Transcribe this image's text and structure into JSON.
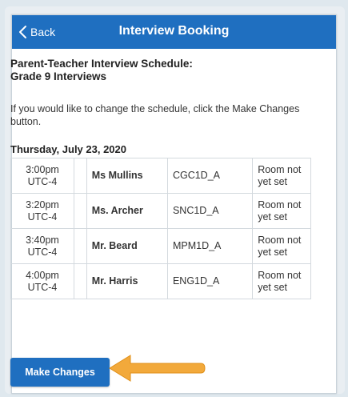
{
  "navbar": {
    "back_label": "Back",
    "title": "Interview Booking",
    "color": "#1f6fc0"
  },
  "schedule": {
    "title_line1": "Parent-Teacher Interview Schedule:",
    "title_line2": "Grade 9 Interviews",
    "instructions": "If you would like to change the schedule, click the Make Changes button.",
    "date": "Thursday, July 23, 2020",
    "rows": [
      {
        "time": "3:00pm",
        "tz": "UTC-4",
        "teacher": "Ms Mullins",
        "course": "CGC1D_A",
        "room_line1": "Room not",
        "room_line2": "yet set"
      },
      {
        "time": "3:20pm",
        "tz": "UTC-4",
        "teacher": "Ms. Archer",
        "course": "SNC1D_A",
        "room_line1": "Room not",
        "room_line2": "yet set"
      },
      {
        "time": "3:40pm",
        "tz": "UTC-4",
        "teacher": "Mr. Beard",
        "course": "MPM1D_A",
        "room_line1": "Room not",
        "room_line2": "yet set"
      },
      {
        "time": "4:00pm",
        "tz": "UTC-4",
        "teacher": "Mr. Harris",
        "course": "ENG1D_A",
        "room_line1": "Room not",
        "room_line2": "yet set"
      }
    ]
  },
  "actions": {
    "make_changes_label": "Make Changes"
  },
  "icons": {
    "back": "chevron-left-icon",
    "arrow": "arrow-left-icon"
  },
  "colors": {
    "accent": "#1f6fc0",
    "teacher_link": "#2a6fb8",
    "arrow": "#f2a93b"
  }
}
